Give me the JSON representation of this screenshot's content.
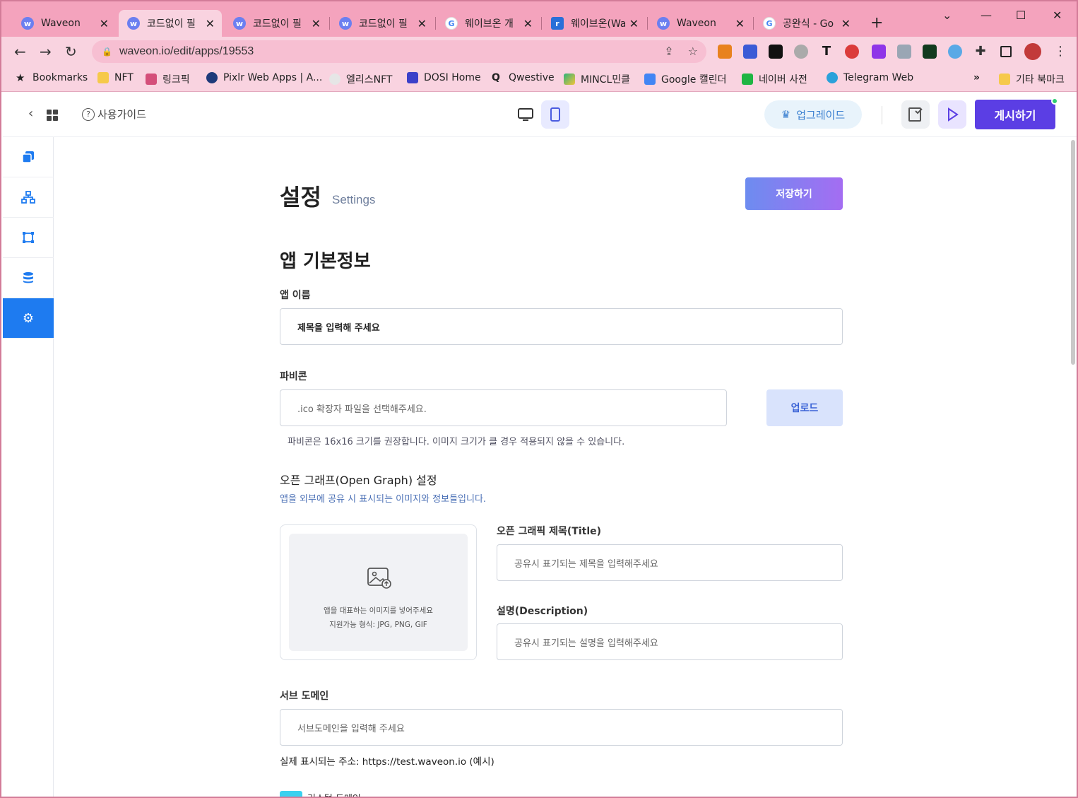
{
  "browser": {
    "tabs": [
      {
        "label": "Waveon",
        "icon": "waveon-icon",
        "color": "#6b7ff0"
      },
      {
        "label": "코드없이 필",
        "icon": "waveon-icon",
        "color": "#6b7ff0"
      },
      {
        "label": "코드없이 필",
        "icon": "waveon-icon",
        "color": "#6b7ff0"
      },
      {
        "label": "코드없이 필",
        "icon": "waveon-icon",
        "color": "#6b7ff0"
      },
      {
        "label": "웨이브온 개",
        "icon": "google-icon",
        "color": "#4285f4"
      },
      {
        "label": "웨이브온(Wa",
        "icon": "site-icon",
        "color": "#2a6fd8"
      },
      {
        "label": "Waveon",
        "icon": "waveon-icon",
        "color": "#6b7ff0"
      },
      {
        "label": "공완식 - Go",
        "icon": "google-icon",
        "color": "#4285f4"
      }
    ],
    "url": "waveon.io/edit/apps/19553",
    "bookmarks": [
      {
        "label": "Bookmarks"
      },
      {
        "label": "NFT"
      },
      {
        "label": "링크픽"
      },
      {
        "label": "Pixlr Web Apps | A..."
      },
      {
        "label": "엘리스NFT"
      },
      {
        "label": "DOSI Home"
      },
      {
        "label": "Qwestive"
      },
      {
        "label": "MINCL민클"
      },
      {
        "label": "Google 캘린더"
      },
      {
        "label": "네이버 사전"
      },
      {
        "label": "Telegram Web"
      }
    ],
    "bookmarks_overflow": "»",
    "other_bookmarks": "기타 북마크"
  },
  "header": {
    "guide_label": "사용가이드",
    "upgrade_label": "업그레이드",
    "publish_label": "게시하기"
  },
  "settings": {
    "title": "설정",
    "subtitle": "Settings",
    "save_label": "저장하기",
    "section_title": "앱 기본정보",
    "app_name_label": "앱 이름",
    "app_name_value": "제목을 입력해 주세요",
    "favicon_label": "파비콘",
    "favicon_placeholder": ".ico 확장자 파일을 선택해주세요.",
    "upload_label": "업로드",
    "favicon_hint": "파비콘은 16x16 크기를 권장합니다. 이미지 크기가 클 경우 적용되지 않을 수 있습니다.",
    "og_title": "오픈 그래프(Open Graph) 설정",
    "og_desc": "앱을 외부에 공유 시 표시되는 이미지와 정보들입니다.",
    "og_image_line1": "앱을 대표하는 이미지를 넣어주세요",
    "og_image_line2": "지원가능 형식: JPG, PNG, GIF",
    "og_title_label": "오픈 그래픽 제목(Title)",
    "og_title_placeholder": "공유시 표기되는 제목을 입력해주세요",
    "og_desc_label": "설명(Description)",
    "og_desc_placeholder": "공유시 표기되는 설명을 입력해주세요",
    "subdomain_label": "서브 도메인",
    "subdomain_placeholder": "서브도메인을 입력해 주세요",
    "subdomain_hint": "실제 표시되는 주소: https://test.waveon.io (예시)",
    "custom_domain_label": "커스텀 도메인"
  },
  "colors": {
    "accent": "#5b3ee4",
    "sidebar_active": "#1e7bf0",
    "browser_frame": "#f4a3bd"
  }
}
